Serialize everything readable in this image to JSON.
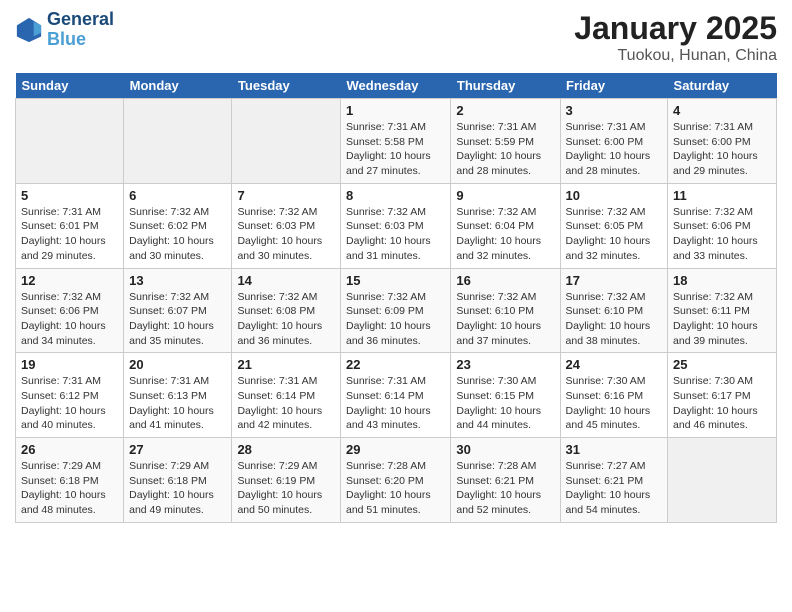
{
  "logo": {
    "line1": "General",
    "line2": "Blue"
  },
  "title": "January 2025",
  "subtitle": "Tuokou, Hunan, China",
  "days_of_week": [
    "Sunday",
    "Monday",
    "Tuesday",
    "Wednesday",
    "Thursday",
    "Friday",
    "Saturday"
  ],
  "weeks": [
    [
      {
        "day": "",
        "sunrise": "",
        "sunset": "",
        "daylight": ""
      },
      {
        "day": "",
        "sunrise": "",
        "sunset": "",
        "daylight": ""
      },
      {
        "day": "",
        "sunrise": "",
        "sunset": "",
        "daylight": ""
      },
      {
        "day": "1",
        "sunrise": "Sunrise: 7:31 AM",
        "sunset": "Sunset: 5:58 PM",
        "daylight": "Daylight: 10 hours and 27 minutes."
      },
      {
        "day": "2",
        "sunrise": "Sunrise: 7:31 AM",
        "sunset": "Sunset: 5:59 PM",
        "daylight": "Daylight: 10 hours and 28 minutes."
      },
      {
        "day": "3",
        "sunrise": "Sunrise: 7:31 AM",
        "sunset": "Sunset: 6:00 PM",
        "daylight": "Daylight: 10 hours and 28 minutes."
      },
      {
        "day": "4",
        "sunrise": "Sunrise: 7:31 AM",
        "sunset": "Sunset: 6:00 PM",
        "daylight": "Daylight: 10 hours and 29 minutes."
      }
    ],
    [
      {
        "day": "5",
        "sunrise": "Sunrise: 7:31 AM",
        "sunset": "Sunset: 6:01 PM",
        "daylight": "Daylight: 10 hours and 29 minutes."
      },
      {
        "day": "6",
        "sunrise": "Sunrise: 7:32 AM",
        "sunset": "Sunset: 6:02 PM",
        "daylight": "Daylight: 10 hours and 30 minutes."
      },
      {
        "day": "7",
        "sunrise": "Sunrise: 7:32 AM",
        "sunset": "Sunset: 6:03 PM",
        "daylight": "Daylight: 10 hours and 30 minutes."
      },
      {
        "day": "8",
        "sunrise": "Sunrise: 7:32 AM",
        "sunset": "Sunset: 6:03 PM",
        "daylight": "Daylight: 10 hours and 31 minutes."
      },
      {
        "day": "9",
        "sunrise": "Sunrise: 7:32 AM",
        "sunset": "Sunset: 6:04 PM",
        "daylight": "Daylight: 10 hours and 32 minutes."
      },
      {
        "day": "10",
        "sunrise": "Sunrise: 7:32 AM",
        "sunset": "Sunset: 6:05 PM",
        "daylight": "Daylight: 10 hours and 32 minutes."
      },
      {
        "day": "11",
        "sunrise": "Sunrise: 7:32 AM",
        "sunset": "Sunset: 6:06 PM",
        "daylight": "Daylight: 10 hours and 33 minutes."
      }
    ],
    [
      {
        "day": "12",
        "sunrise": "Sunrise: 7:32 AM",
        "sunset": "Sunset: 6:06 PM",
        "daylight": "Daylight: 10 hours and 34 minutes."
      },
      {
        "day": "13",
        "sunrise": "Sunrise: 7:32 AM",
        "sunset": "Sunset: 6:07 PM",
        "daylight": "Daylight: 10 hours and 35 minutes."
      },
      {
        "day": "14",
        "sunrise": "Sunrise: 7:32 AM",
        "sunset": "Sunset: 6:08 PM",
        "daylight": "Daylight: 10 hours and 36 minutes."
      },
      {
        "day": "15",
        "sunrise": "Sunrise: 7:32 AM",
        "sunset": "Sunset: 6:09 PM",
        "daylight": "Daylight: 10 hours and 36 minutes."
      },
      {
        "day": "16",
        "sunrise": "Sunrise: 7:32 AM",
        "sunset": "Sunset: 6:10 PM",
        "daylight": "Daylight: 10 hours and 37 minutes."
      },
      {
        "day": "17",
        "sunrise": "Sunrise: 7:32 AM",
        "sunset": "Sunset: 6:10 PM",
        "daylight": "Daylight: 10 hours and 38 minutes."
      },
      {
        "day": "18",
        "sunrise": "Sunrise: 7:32 AM",
        "sunset": "Sunset: 6:11 PM",
        "daylight": "Daylight: 10 hours and 39 minutes."
      }
    ],
    [
      {
        "day": "19",
        "sunrise": "Sunrise: 7:31 AM",
        "sunset": "Sunset: 6:12 PM",
        "daylight": "Daylight: 10 hours and 40 minutes."
      },
      {
        "day": "20",
        "sunrise": "Sunrise: 7:31 AM",
        "sunset": "Sunset: 6:13 PM",
        "daylight": "Daylight: 10 hours and 41 minutes."
      },
      {
        "day": "21",
        "sunrise": "Sunrise: 7:31 AM",
        "sunset": "Sunset: 6:14 PM",
        "daylight": "Daylight: 10 hours and 42 minutes."
      },
      {
        "day": "22",
        "sunrise": "Sunrise: 7:31 AM",
        "sunset": "Sunset: 6:14 PM",
        "daylight": "Daylight: 10 hours and 43 minutes."
      },
      {
        "day": "23",
        "sunrise": "Sunrise: 7:30 AM",
        "sunset": "Sunset: 6:15 PM",
        "daylight": "Daylight: 10 hours and 44 minutes."
      },
      {
        "day": "24",
        "sunrise": "Sunrise: 7:30 AM",
        "sunset": "Sunset: 6:16 PM",
        "daylight": "Daylight: 10 hours and 45 minutes."
      },
      {
        "day": "25",
        "sunrise": "Sunrise: 7:30 AM",
        "sunset": "Sunset: 6:17 PM",
        "daylight": "Daylight: 10 hours and 46 minutes."
      }
    ],
    [
      {
        "day": "26",
        "sunrise": "Sunrise: 7:29 AM",
        "sunset": "Sunset: 6:18 PM",
        "daylight": "Daylight: 10 hours and 48 minutes."
      },
      {
        "day": "27",
        "sunrise": "Sunrise: 7:29 AM",
        "sunset": "Sunset: 6:18 PM",
        "daylight": "Daylight: 10 hours and 49 minutes."
      },
      {
        "day": "28",
        "sunrise": "Sunrise: 7:29 AM",
        "sunset": "Sunset: 6:19 PM",
        "daylight": "Daylight: 10 hours and 50 minutes."
      },
      {
        "day": "29",
        "sunrise": "Sunrise: 7:28 AM",
        "sunset": "Sunset: 6:20 PM",
        "daylight": "Daylight: 10 hours and 51 minutes."
      },
      {
        "day": "30",
        "sunrise": "Sunrise: 7:28 AM",
        "sunset": "Sunset: 6:21 PM",
        "daylight": "Daylight: 10 hours and 52 minutes."
      },
      {
        "day": "31",
        "sunrise": "Sunrise: 7:27 AM",
        "sunset": "Sunset: 6:21 PM",
        "daylight": "Daylight: 10 hours and 54 minutes."
      },
      {
        "day": "",
        "sunrise": "",
        "sunset": "",
        "daylight": ""
      }
    ]
  ]
}
